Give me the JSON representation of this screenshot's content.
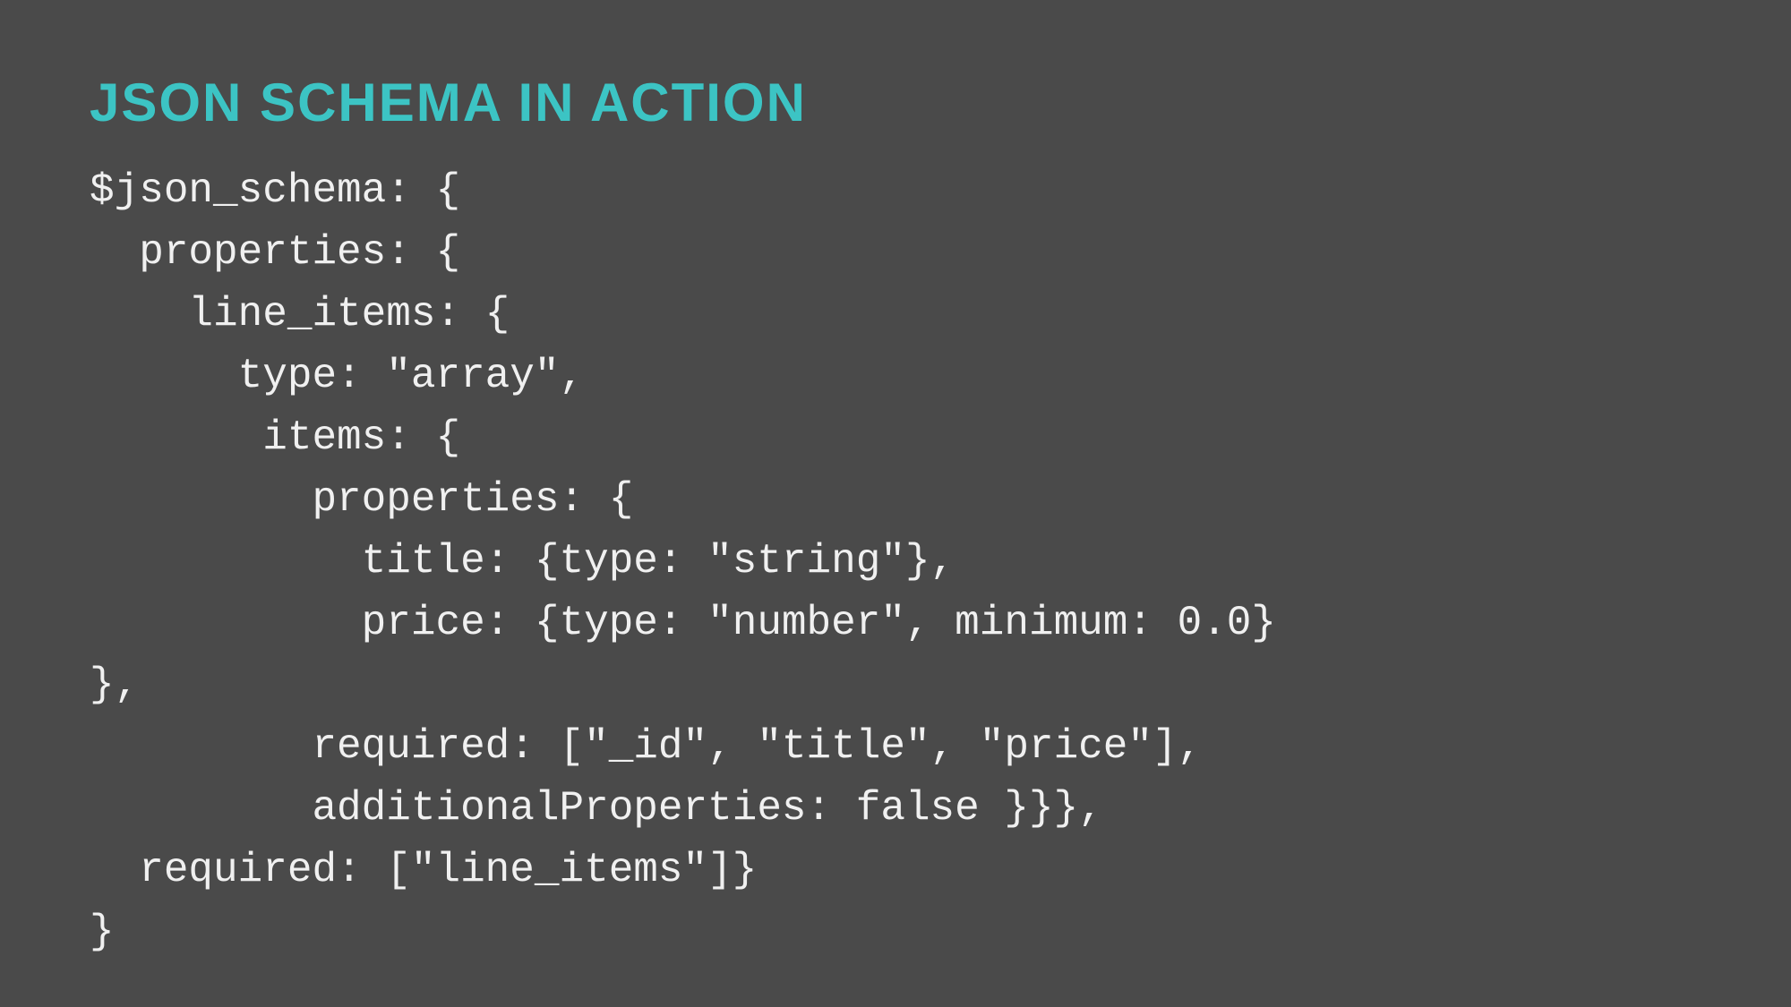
{
  "title": "JSON SCHEMA IN ACTION",
  "code": "$json_schema: {\n  properties: {\n    line_items: {\n      type: \"array\",\n       items: {\n         properties: {\n           title: {type: \"string\"},\n           price: {type: \"number\", minimum: 0.0}\n},\n         required: [\"_id\", \"title\", \"price\"],\n         additionalProperties: false }}},\n  required: [\"line_items\"]}\n}"
}
